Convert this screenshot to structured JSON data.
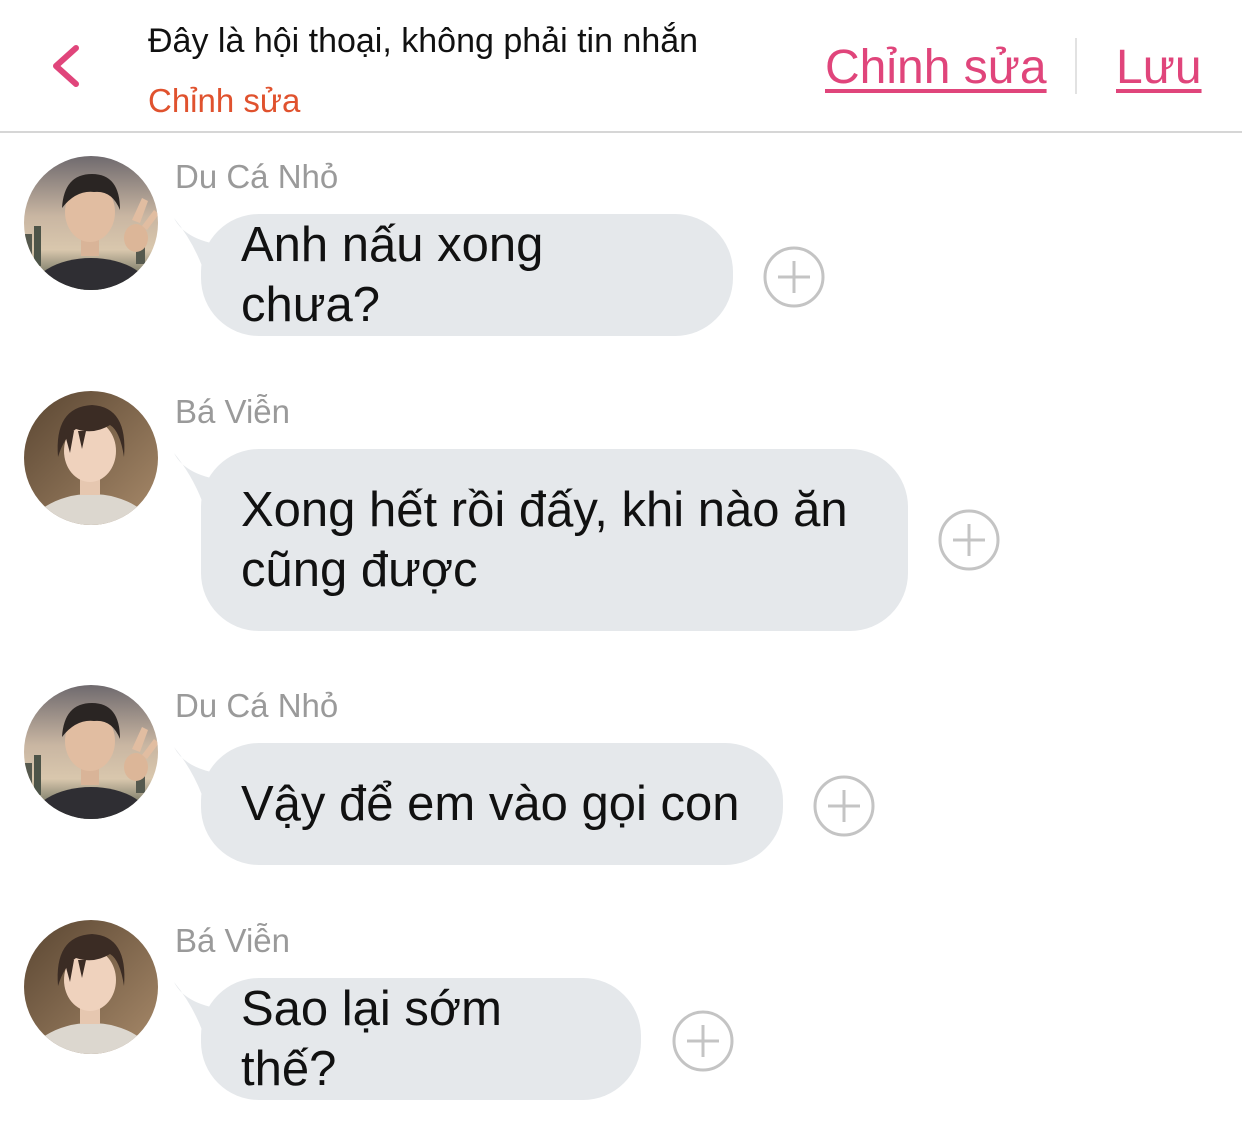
{
  "header": {
    "title": "Đây là hội thoại, không phải tin nhắn",
    "subtitle": "Chỉnh sửa",
    "edit_label": "Chỉnh sửa",
    "save_label": "Lưu"
  },
  "colors": {
    "accent": "#e0457b",
    "subtitle": "#e0522e",
    "bubble": "#e5e8eb",
    "sender": "#9a9a9a"
  },
  "messages": [
    {
      "sender": "Du Cá Nhỏ",
      "text": "Anh nấu xong chưa?"
    },
    {
      "sender": "Bá Viễn",
      "text": "Xong hết rồi đấy, khi nào ăn cũng được"
    },
    {
      "sender": "Du Cá Nhỏ",
      "text": "Vậy để em vào gọi con"
    },
    {
      "sender": "Bá Viễn",
      "text": "Sao lại sớm thế?"
    }
  ]
}
